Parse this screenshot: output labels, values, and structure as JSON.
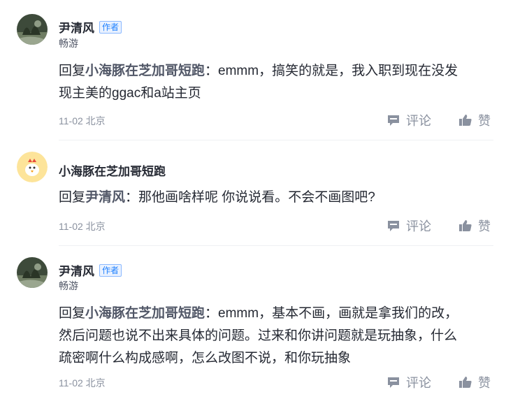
{
  "comments": [
    {
      "author": "尹清风",
      "badge": "作者",
      "subtitle": "畅游",
      "reply_prefix": "回复",
      "reply_to": "小海豚在芝加哥短跑",
      "text_line1": "：emmm，搞笑的就是，我入职到现在没发",
      "text_line2": "现主美的ggac和a站主页",
      "meta": "11-02 北京",
      "comment_label": "评论",
      "like_label": "赞"
    },
    {
      "author": "小海豚在芝加哥短跑",
      "reply_prefix": "回复",
      "reply_to": "尹清风",
      "text_line1": "：那他画啥样呢 你说说看。不会不画图吧?",
      "meta": "11-02 北京",
      "comment_label": "评论",
      "like_label": "赞"
    },
    {
      "author": "尹清风",
      "badge": "作者",
      "subtitle": "畅游",
      "reply_prefix": "回复",
      "reply_to": "小海豚在芝加哥短跑",
      "text_line1": "：emmm，基本不画，画就是拿我们的改，",
      "text_line2": "然后问题也说不出来具体的问题。过来和你讲问题就是玩抽象，什么",
      "text_line3": "疏密啊什么构成感啊，怎么改图不说，和你玩抽象",
      "meta": "11-02 北京",
      "comment_label": "评论",
      "like_label": "赞"
    }
  ]
}
